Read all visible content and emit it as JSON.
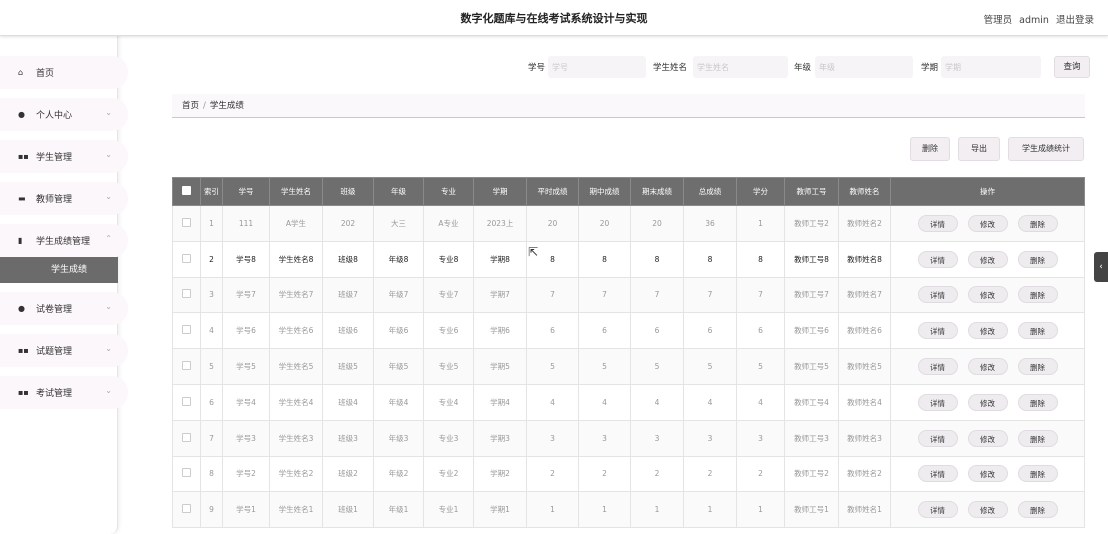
{
  "header": {
    "title": "数字化题库与在线考试系统设计与实现",
    "user_role": "管理员",
    "username": "admin",
    "logout": "退出登录"
  },
  "sidebar": {
    "items": [
      {
        "label": "首页",
        "icon": "home-icon",
        "glyph": "🏠︎"
      },
      {
        "label": "个人中心",
        "icon": "user-icon",
        "glyph": "👤︎"
      },
      {
        "label": "学生管理",
        "icon": "grid-icon",
        "glyph": "▪▪"
      },
      {
        "label": "教师管理",
        "icon": "id-card-icon",
        "glyph": "▬"
      },
      {
        "label": "学生成绩管理",
        "icon": "clipboard-icon",
        "glyph": "▮"
      },
      {
        "label": "试卷管理",
        "icon": "user-icon",
        "glyph": "👤︎"
      },
      {
        "label": "试题管理",
        "icon": "grid-icon",
        "glyph": "▪▪"
      },
      {
        "label": "考试管理",
        "icon": "grid-icon",
        "glyph": "▪▪"
      }
    ],
    "submenu_label": "学生成绩"
  },
  "search": {
    "student_no_label": "学号",
    "student_no_placeholder": "学号",
    "student_name_label": "学生姓名",
    "student_name_placeholder": "学生姓名",
    "grade_label": "年级",
    "grade_placeholder": "年级",
    "term_label": "学期",
    "term_placeholder": "学期",
    "query_button": "查询"
  },
  "breadcrumb": {
    "home": "首页",
    "separator": "/",
    "current": "学生成绩"
  },
  "actions": {
    "delete": "删除",
    "export": "导出",
    "stats": "学生成绩统计"
  },
  "table": {
    "headers": [
      "索引",
      "学号",
      "学生姓名",
      "班级",
      "年级",
      "专业",
      "学期",
      "平时成绩",
      "期中成绩",
      "期末成绩",
      "总成绩",
      "学分",
      "教师工号",
      "教师姓名",
      "操作"
    ],
    "row_buttons": {
      "detail": "详情",
      "edit": "修改",
      "delete": "删除"
    },
    "rows": [
      [
        "1",
        "111",
        "A学生",
        "202",
        "大三",
        "A专业",
        "2023上",
        "20",
        "20",
        "20",
        "36",
        "1",
        "教师工号2",
        "教师姓名2"
      ],
      [
        "2",
        "学号8",
        "学生姓名8",
        "班级8",
        "年级8",
        "专业8",
        "学期8",
        "8",
        "8",
        "8",
        "8",
        "8",
        "教师工号8",
        "教师姓名8"
      ],
      [
        "3",
        "学号7",
        "学生姓名7",
        "班级7",
        "年级7",
        "专业7",
        "学期7",
        "7",
        "7",
        "7",
        "7",
        "7",
        "教师工号7",
        "教师姓名7"
      ],
      [
        "4",
        "学号6",
        "学生姓名6",
        "班级6",
        "年级6",
        "专业6",
        "学期6",
        "6",
        "6",
        "6",
        "6",
        "6",
        "教师工号6",
        "教师姓名6"
      ],
      [
        "5",
        "学号5",
        "学生姓名5",
        "班级5",
        "年级5",
        "专业5",
        "学期5",
        "5",
        "5",
        "5",
        "5",
        "5",
        "教师工号5",
        "教师姓名5"
      ],
      [
        "6",
        "学号4",
        "学生姓名4",
        "班级4",
        "年级4",
        "专业4",
        "学期4",
        "4",
        "4",
        "4",
        "4",
        "4",
        "教师工号4",
        "教师姓名4"
      ],
      [
        "7",
        "学号3",
        "学生姓名3",
        "班级3",
        "年级3",
        "专业3",
        "学期3",
        "3",
        "3",
        "3",
        "3",
        "3",
        "教师工号3",
        "教师姓名3"
      ],
      [
        "8",
        "学号2",
        "学生姓名2",
        "班级2",
        "年级2",
        "专业2",
        "学期2",
        "2",
        "2",
        "2",
        "2",
        "2",
        "教师工号2",
        "教师姓名2"
      ],
      [
        "9",
        "学号1",
        "学生姓名1",
        "班级1",
        "年级1",
        "专业1",
        "学期1",
        "1",
        "1",
        "1",
        "1",
        "1",
        "教师工号1",
        "教师姓名1"
      ]
    ]
  },
  "edge_tab": "‹"
}
